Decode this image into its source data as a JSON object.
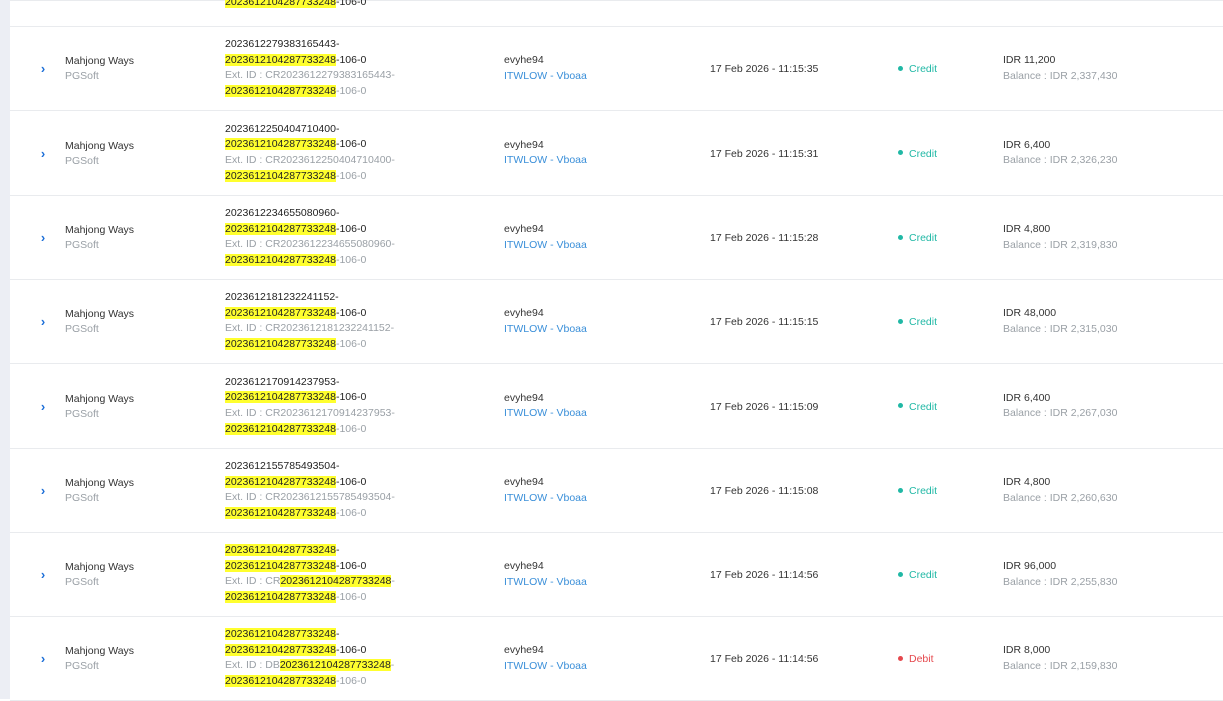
{
  "colors": {
    "credit": "#20b8a5",
    "debit": "#e5484d",
    "highlight": "#ffff2e",
    "agent_link": "#3a8fd9"
  },
  "partial_row": {
    "prefix": "",
    "highlight": "2023612104287733248",
    "suffix": "-106-0"
  },
  "rows": [
    {
      "expand_icon": "chevron-right-icon",
      "game": "Mahjong Ways",
      "provider": "PGSoft",
      "txn_line1_pre": "2023612279383165443-",
      "txn_line1_hl": "",
      "txn_line2_hl": "2023612104287733248",
      "txn_line2_suf": "-106-0",
      "ext_pre": "Ext. ID : CR2023612279383165443-",
      "ext_hl": "",
      "ext2_hl": "2023612104287733248",
      "ext2_suf": "-106-0",
      "username": "evyhe94",
      "agent": "ITWLOW - Vboaa",
      "datetime": "17 Feb 2026 - 11:15:35",
      "type": "Credit",
      "type_color": "#20b8a5",
      "amount": "IDR 11,200",
      "balance": "Balance : IDR 2,337,430"
    },
    {
      "expand_icon": "chevron-right-icon",
      "game": "Mahjong Ways",
      "provider": "PGSoft",
      "txn_line1_pre": "2023612250404710400-",
      "txn_line1_hl": "",
      "txn_line2_hl": "2023612104287733248",
      "txn_line2_suf": "-106-0",
      "ext_pre": "Ext. ID : CR2023612250404710400-",
      "ext_hl": "",
      "ext2_hl": "2023612104287733248",
      "ext2_suf": "-106-0",
      "username": "evyhe94",
      "agent": "ITWLOW - Vboaa",
      "datetime": "17 Feb 2026 - 11:15:31",
      "type": "Credit",
      "type_color": "#20b8a5",
      "amount": "IDR 6,400",
      "balance": "Balance : IDR 2,326,230"
    },
    {
      "expand_icon": "chevron-right-icon",
      "game": "Mahjong Ways",
      "provider": "PGSoft",
      "txn_line1_pre": "2023612234655080960-",
      "txn_line1_hl": "",
      "txn_line2_hl": "2023612104287733248",
      "txn_line2_suf": "-106-0",
      "ext_pre": "Ext. ID : CR2023612234655080960-",
      "ext_hl": "",
      "ext2_hl": "2023612104287733248",
      "ext2_suf": "-106-0",
      "username": "evyhe94",
      "agent": "ITWLOW - Vboaa",
      "datetime": "17 Feb 2026 - 11:15:28",
      "type": "Credit",
      "type_color": "#20b8a5",
      "amount": "IDR 4,800",
      "balance": "Balance : IDR 2,319,830"
    },
    {
      "expand_icon": "chevron-right-icon",
      "game": "Mahjong Ways",
      "provider": "PGSoft",
      "txn_line1_pre": "2023612181232241152-",
      "txn_line1_hl": "",
      "txn_line2_hl": "2023612104287733248",
      "txn_line2_suf": "-106-0",
      "ext_pre": "Ext. ID : CR2023612181232241152-",
      "ext_hl": "",
      "ext2_hl": "2023612104287733248",
      "ext2_suf": "-106-0",
      "username": "evyhe94",
      "agent": "ITWLOW - Vboaa",
      "datetime": "17 Feb 2026 - 11:15:15",
      "type": "Credit",
      "type_color": "#20b8a5",
      "amount": "IDR 48,000",
      "balance": "Balance : IDR 2,315,030"
    },
    {
      "expand_icon": "chevron-right-icon",
      "game": "Mahjong Ways",
      "provider": "PGSoft",
      "txn_line1_pre": "2023612170914237953-",
      "txn_line1_hl": "",
      "txn_line2_hl": "2023612104287733248",
      "txn_line2_suf": "-106-0",
      "ext_pre": "Ext. ID : CR2023612170914237953-",
      "ext_hl": "",
      "ext2_hl": "2023612104287733248",
      "ext2_suf": "-106-0",
      "username": "evyhe94",
      "agent": "ITWLOW - Vboaa",
      "datetime": "17 Feb 2026 - 11:15:09",
      "type": "Credit",
      "type_color": "#20b8a5",
      "amount": "IDR 6,400",
      "balance": "Balance : IDR 2,267,030"
    },
    {
      "expand_icon": "chevron-right-icon",
      "game": "Mahjong Ways",
      "provider": "PGSoft",
      "txn_line1_pre": "2023612155785493504-",
      "txn_line1_hl": "",
      "txn_line2_hl": "2023612104287733248",
      "txn_line2_suf": "-106-0",
      "ext_pre": "Ext. ID : CR2023612155785493504-",
      "ext_hl": "",
      "ext2_hl": "2023612104287733248",
      "ext2_suf": "-106-0",
      "username": "evyhe94",
      "agent": "ITWLOW - Vboaa",
      "datetime": "17 Feb 2026 - 11:15:08",
      "type": "Credit",
      "type_color": "#20b8a5",
      "amount": "IDR 4,800",
      "balance": "Balance : IDR 2,260,630"
    },
    {
      "expand_icon": "chevron-right-icon",
      "game": "Mahjong Ways",
      "provider": "PGSoft",
      "txn_line1_pre": "",
      "txn_line1_hl": "2023612104287733248",
      "txn_line1_suf": "-",
      "txn_line2_hl": "2023612104287733248",
      "txn_line2_suf": "-106-0",
      "ext_pre": "Ext. ID : CR",
      "ext_hl": "2023612104287733248",
      "ext_suf": "-",
      "ext2_hl": "2023612104287733248",
      "ext2_suf": "-106-0",
      "username": "evyhe94",
      "agent": "ITWLOW - Vboaa",
      "datetime": "17 Feb 2026 - 11:14:56",
      "type": "Credit",
      "type_color": "#20b8a5",
      "amount": "IDR 96,000",
      "balance": "Balance : IDR 2,255,830"
    },
    {
      "expand_icon": "chevron-right-icon",
      "game": "Mahjong Ways",
      "provider": "PGSoft",
      "txn_line1_pre": "",
      "txn_line1_hl": "2023612104287733248",
      "txn_line1_suf": "-",
      "txn_line2_hl": "2023612104287733248",
      "txn_line2_suf": "-106-0",
      "ext_pre": "Ext. ID : DB",
      "ext_hl": "2023612104287733248",
      "ext_suf": "-",
      "ext2_hl": "2023612104287733248",
      "ext2_suf": "-106-0",
      "username": "evyhe94",
      "agent": "ITWLOW - Vboaa",
      "datetime": "17 Feb 2026 - 11:14:56",
      "type": "Debit",
      "type_color": "#e5484d",
      "amount": "IDR 8,000",
      "balance": "Balance : IDR 2,159,830"
    }
  ]
}
